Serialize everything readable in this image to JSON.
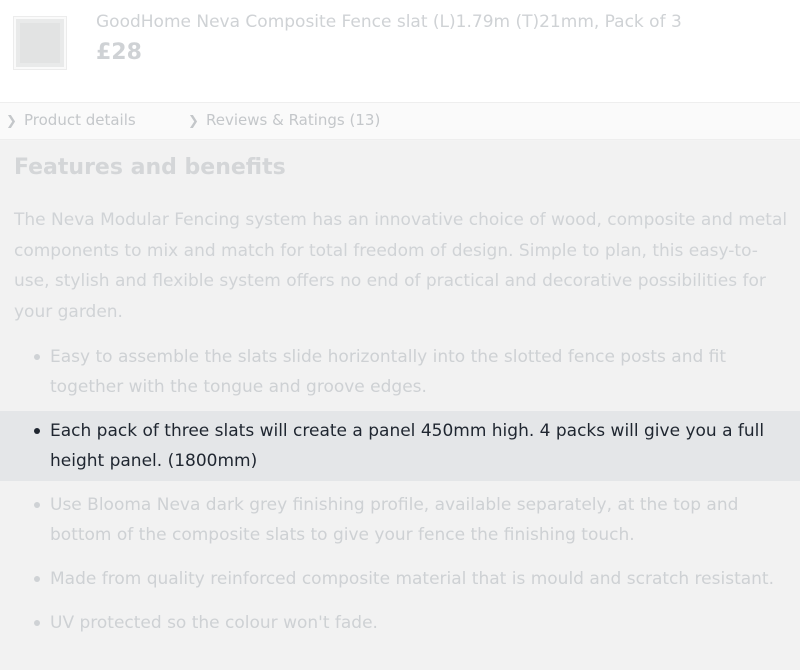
{
  "product": {
    "name": "GoodHome Neva Composite Fence slat (L)1.79m (T)21mm, Pack of 3",
    "price": "£28",
    "thumbnail_icon": "fence-slat-image"
  },
  "tabs": [
    {
      "label": "Product details",
      "icon": "chevron-right-icon"
    },
    {
      "label": "Reviews & Ratings (13)",
      "icon": "chevron-right-icon"
    }
  ],
  "features": {
    "title": "Features and benefits",
    "intro": "The Neva Modular Fencing system has an innovative choice of wood, composite and metal components to mix and match for total freedom of design. Simple to plan, this easy-to-use, stylish and flexible system offers no end of practical and decorative possibilities for your garden.",
    "bullets": [
      "Easy to assemble the slats slide horizontally into the slotted fence posts and fit together with the tongue and groove edges.",
      "Each pack of three slats will create a panel 450mm high. 4 packs will give you a full height panel. (1800mm)",
      "Use Blooma Neva dark grey finishing profile, available separately, at the top and bottom of the composite slats to give your fence the finishing touch.",
      "Made from quality reinforced composite material that is mould and scratch resistant.",
      "UV protected so the colour won't fade."
    ],
    "highlighted_index": 1
  },
  "colors": {
    "highlight_background": "#e4e6e8",
    "faded_text": "#ced1d4",
    "active_text": "#1f2630"
  }
}
